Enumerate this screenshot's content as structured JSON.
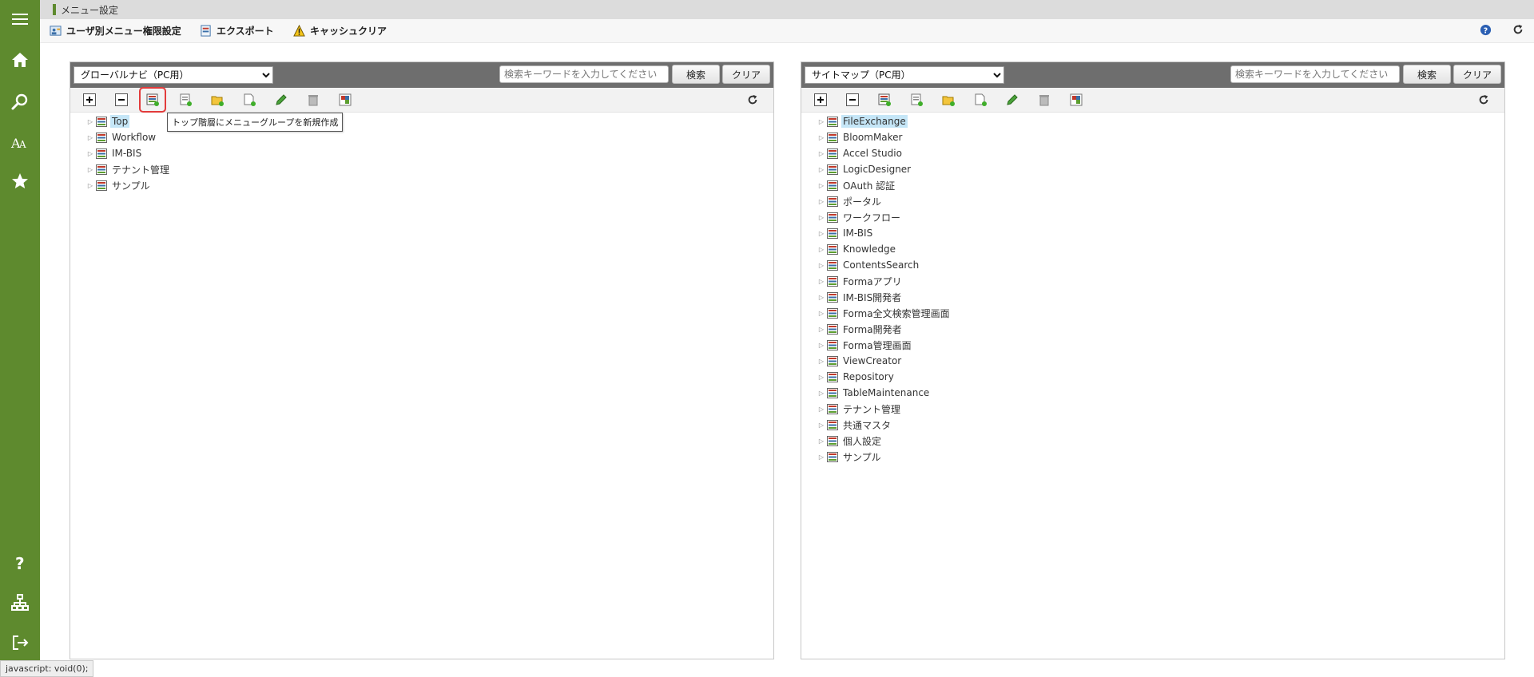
{
  "window": {
    "title": "メニュー設定"
  },
  "colors": {
    "nav_bg": "#5e8a2e",
    "selected": "#c5e6f7",
    "highlight": "#e23b3b"
  },
  "leftnav": {
    "top_icons": [
      "menu-icon",
      "home-icon",
      "search-icon",
      "font-icon",
      "star-icon"
    ],
    "bottom_icons": [
      "help-icon",
      "sitemap-icon",
      "logout-icon"
    ]
  },
  "toolbar": {
    "user_menu_permission": "ユーザ別メニュー権限設定",
    "export": "エクスポート",
    "cache_clear": "キャッシュクリア"
  },
  "left_panel": {
    "select_value": "グローバルナビ（PC用）",
    "search_placeholder": "検索キーワードを入力してください",
    "search_button": "検索",
    "clear_button": "クリア",
    "tooltip": "トップ階層にメニューグループを新規作成",
    "tree": [
      "Top",
      "Workflow",
      "IM-BIS",
      "テナント管理",
      "サンプル"
    ],
    "selected_index": 0
  },
  "right_panel": {
    "select_value": "サイトマップ（PC用）",
    "search_placeholder": "検索キーワードを入力してください",
    "search_button": "検索",
    "clear_button": "クリア",
    "tree": [
      "FileExchange",
      "BloomMaker",
      "Accel Studio",
      "LogicDesigner",
      "OAuth 認証",
      "ポータル",
      "ワークフロー",
      "IM-BIS",
      "Knowledge",
      "ContentsSearch",
      "Formaアプリ",
      "IM-BIS開発者",
      "Forma全文検索管理画面",
      "Forma開発者",
      "Forma管理画面",
      "ViewCreator",
      "Repository",
      "TableMaintenance",
      "テナント管理",
      "共通マスタ",
      "個人設定",
      "サンプル"
    ],
    "selected_index": 0
  },
  "tools": [
    "expand-all-icon",
    "collapse-all-icon",
    "new-top-menu-group-icon",
    "new-menu-group-icon",
    "new-folder-icon",
    "new-menu-item-icon",
    "edit-icon",
    "delete-icon",
    "reorder-icon"
  ],
  "status_text": "javascript: void(0);"
}
